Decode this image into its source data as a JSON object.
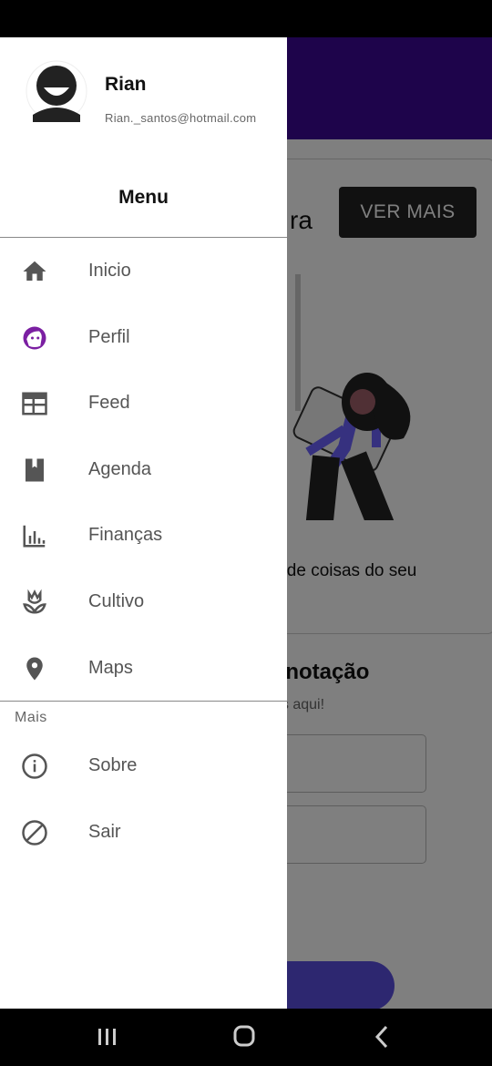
{
  "background": {
    "card_title_fragment": "ra",
    "ver_mais_label": "VER MAIS",
    "card_text_fragment": "s de coisas do seu",
    "section_title_fragment": "anotação",
    "section_sub_fragment": "es aqui!"
  },
  "drawer": {
    "user": {
      "name": "Rian",
      "email": "Rian._santos@hotmail.com"
    },
    "menu_title": "Menu",
    "items": [
      {
        "label": "Inicio",
        "icon": "home-icon"
      },
      {
        "label": "Perfil",
        "icon": "face-icon"
      },
      {
        "label": "Feed",
        "icon": "feed-icon"
      },
      {
        "label": "Agenda",
        "icon": "book-icon"
      },
      {
        "label": "Finanças",
        "icon": "chart-icon"
      },
      {
        "label": "Cultivo",
        "icon": "flower-icon"
      },
      {
        "label": "Maps",
        "icon": "location-pin-icon"
      }
    ],
    "more_section_label": "Mais",
    "more_items": [
      {
        "label": "Sobre",
        "icon": "info-icon"
      },
      {
        "label": "Sair",
        "icon": "block-icon"
      }
    ]
  },
  "colors": {
    "appbar": "#3d0896",
    "accent": "#5b4fe0",
    "perfil_icon": "#7b1fa2"
  },
  "navbar": {
    "buttons": [
      "recent-apps-icon",
      "home-button-icon",
      "back-icon"
    ]
  }
}
